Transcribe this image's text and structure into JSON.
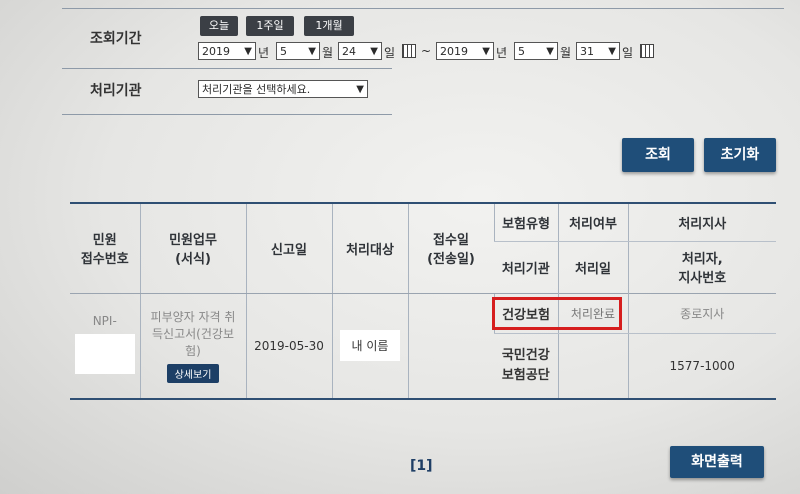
{
  "search": {
    "period_label": "조회기간",
    "quick_buttons": [
      "오늘",
      "1주일",
      "1개월"
    ],
    "from": {
      "year": "2019",
      "month": "5",
      "day": "24"
    },
    "to": {
      "year": "2019",
      "month": "5",
      "day": "31"
    },
    "unit_year": "년",
    "unit_month": "월",
    "unit_day": "일",
    "tilde": "~",
    "agency_label": "처리기관",
    "agency_value": "처리기관을 선택하세요.",
    "search_button": "조회",
    "reset_button": "초기화"
  },
  "table": {
    "headers": {
      "receipt_no": "민원\n접수번호",
      "task": "민원업무\n(서식)",
      "report_date": "신고일",
      "target": "처리대상",
      "received_date": "접수일\n(전송일)",
      "insurance_type": "보험유형",
      "processed": "처리여부",
      "branch": "처리지사",
      "agency": "처리기관",
      "processed_date": "처리일",
      "handler": "처리자,\n지사번호"
    },
    "row": {
      "receipt_no": "NPI-",
      "task": "피부양자 자격 취득신고서(건강보험)",
      "detail_button": "상세보기",
      "report_date": "2019-05-30",
      "target": "내 이름",
      "insurance1": "건강보험",
      "status1": "처리완료",
      "branch1": "종로지사",
      "insurance2": "국민건강\n보험공단",
      "phone2": "1577-1000"
    }
  },
  "footer": {
    "page": "[1]",
    "print_button": "화면출력"
  },
  "colors": {
    "highlight": "#d61e1e",
    "button_dark": "#1f4e79"
  }
}
